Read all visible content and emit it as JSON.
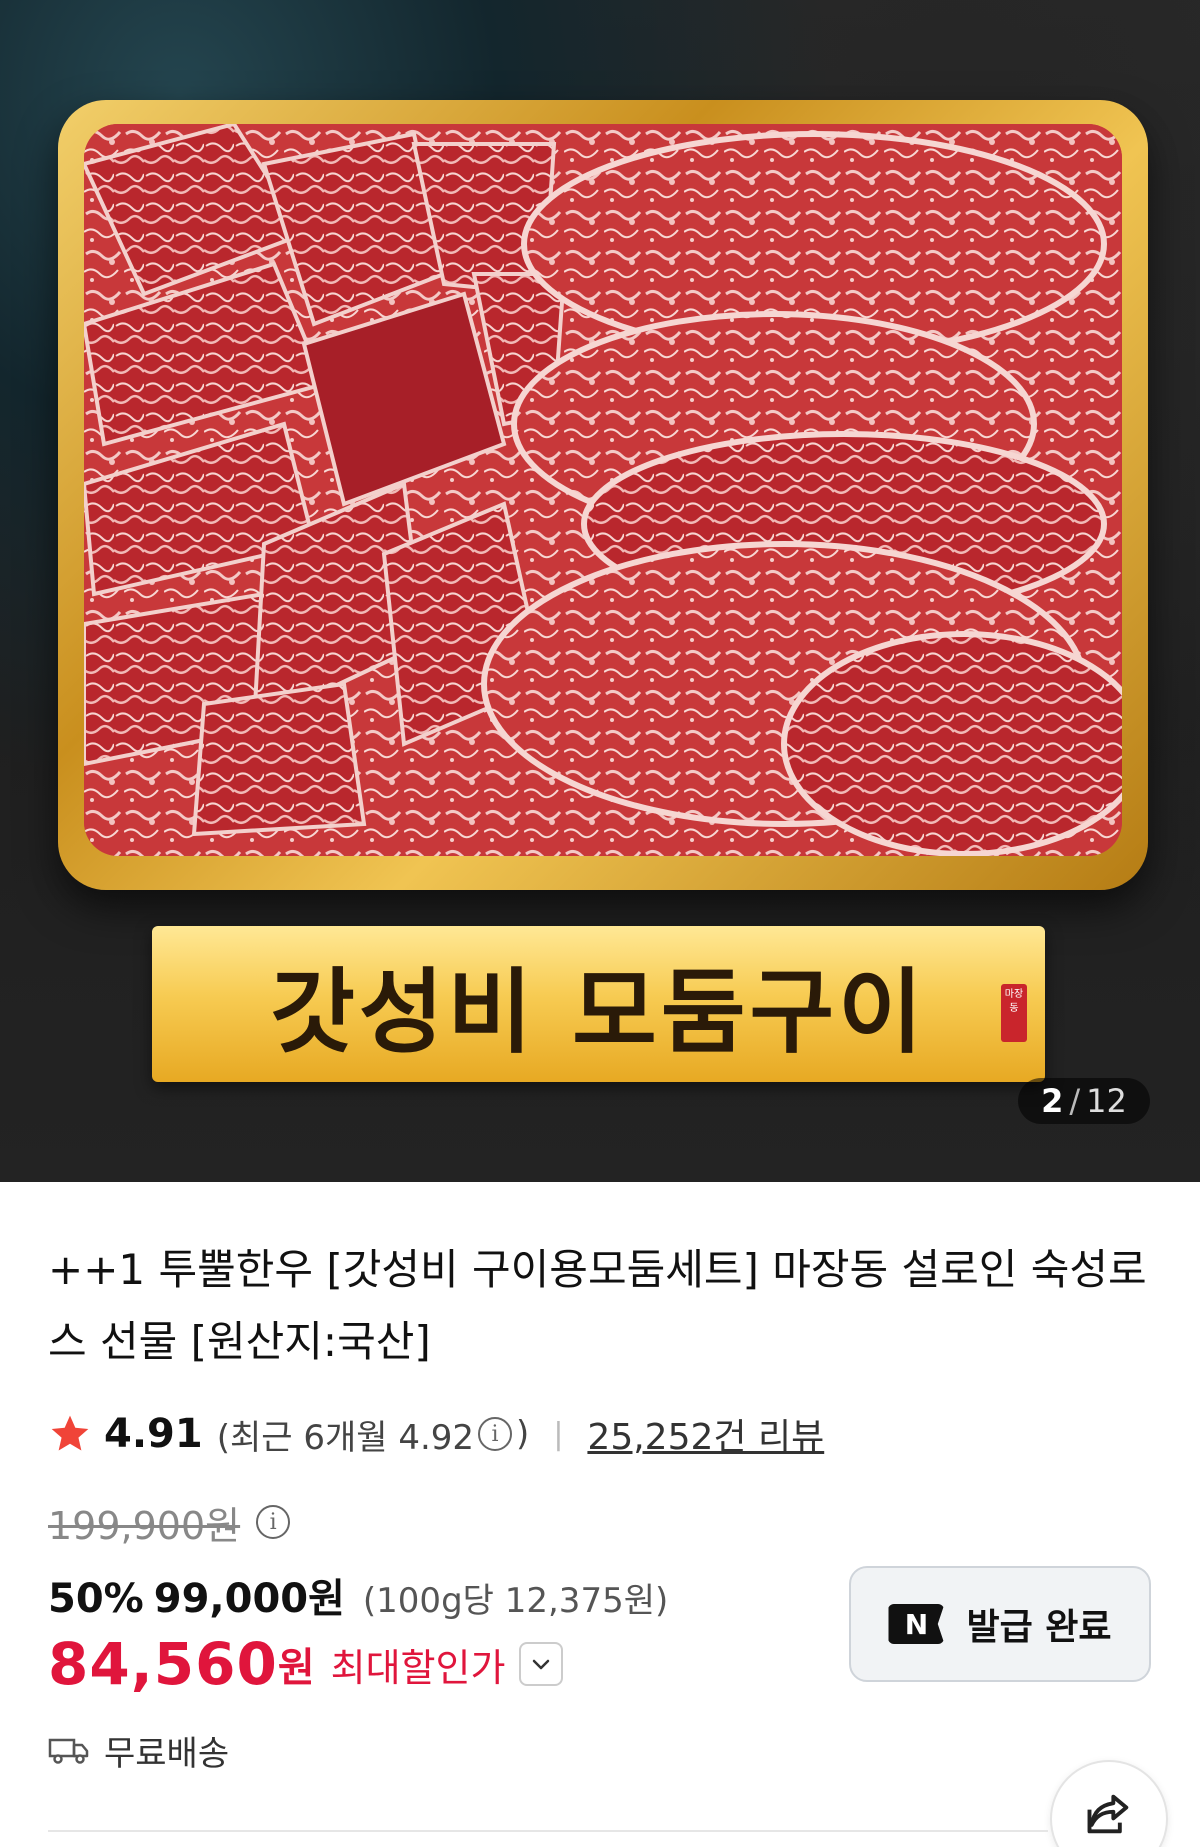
{
  "gallery": {
    "banner_text": "갓성비 모둠구이",
    "seal_text": "마장동",
    "current": "2",
    "separator": "/",
    "total": "12"
  },
  "product": {
    "title": "++1 투뿔한우 [갓성비 구이용모둠세트] 마장동 설로인 숙성로스 선물 [원산지:국산]",
    "rating": "4.91",
    "recent_open": "(최근 6개월 4.92",
    "recent_close": ")",
    "review_count": "25,252건 리뷰"
  },
  "price": {
    "original": "199,900원",
    "discount_rate": "50%",
    "sale_price": "99,000원",
    "per_unit": "(100g당 12,375원)",
    "max_discount_value": "84,560",
    "max_discount_unit": "원",
    "max_discount_label": "최대할인가"
  },
  "coupon": {
    "badge": "N",
    "label": "발급 완료"
  },
  "delivery": {
    "label": "무료배송"
  },
  "colors": {
    "accent_red": "#e0153c",
    "star": "#f04438"
  },
  "icons": {
    "rating": "star-icon",
    "info": "info-icon",
    "dropdown": "chevron-down-icon",
    "delivery": "truck-icon",
    "share": "share-icon"
  }
}
